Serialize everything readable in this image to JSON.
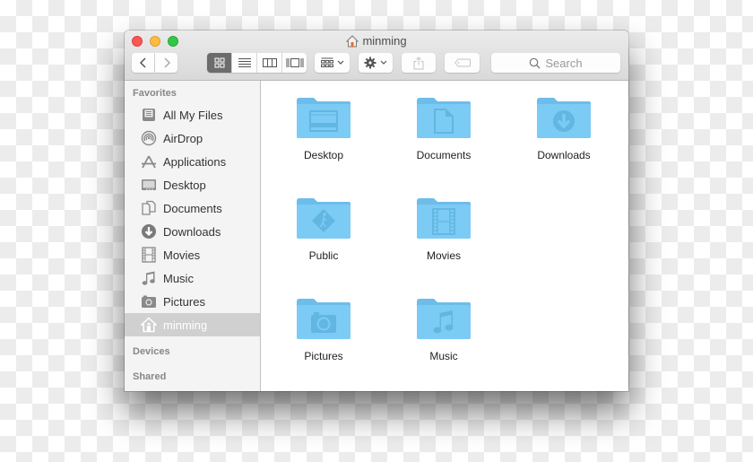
{
  "window": {
    "title": "minming",
    "title_icon": "home-icon"
  },
  "toolbar": {
    "back_icon": "chevron-left-icon",
    "forward_icon": "chevron-right-icon",
    "view_modes": [
      {
        "name": "icon-view",
        "icon": "grid-icon",
        "active": true
      },
      {
        "name": "list-view",
        "icon": "list-icon",
        "active": false
      },
      {
        "name": "column-view",
        "icon": "columns-icon",
        "active": false
      },
      {
        "name": "cover-flow-view",
        "icon": "cover-flow-icon",
        "active": false
      }
    ],
    "arrange_icon": "arrange-grid-icon",
    "action_icon": "gear-icon",
    "share_icon": "share-icon",
    "tag_icon": "tag-icon",
    "search_placeholder": "Search"
  },
  "sidebar": {
    "favorites_heading": "Favorites",
    "items": [
      {
        "label": "All My Files",
        "icon": "all-files-icon"
      },
      {
        "label": "AirDrop",
        "icon": "airdrop-icon"
      },
      {
        "label": "Applications",
        "icon": "applications-icon"
      },
      {
        "label": "Desktop",
        "icon": "desktop-icon"
      },
      {
        "label": "Documents",
        "icon": "documents-icon"
      },
      {
        "label": "Downloads",
        "icon": "downloads-icon"
      },
      {
        "label": "Movies",
        "icon": "movies-icon"
      },
      {
        "label": "Music",
        "icon": "music-icon"
      },
      {
        "label": "Pictures",
        "icon": "pictures-icon"
      },
      {
        "label": "minming",
        "icon": "home-icon",
        "selected": true
      }
    ],
    "devices_heading": "Devices",
    "shared_heading": "Shared"
  },
  "folders": [
    {
      "label": "Desktop",
      "glyph": "desktop"
    },
    {
      "label": "Documents",
      "glyph": "document"
    },
    {
      "label": "Downloads",
      "glyph": "download"
    },
    {
      "label": "Public",
      "glyph": "public"
    },
    {
      "label": "Movies",
      "glyph": "film"
    },
    {
      "label": "Pictures",
      "glyph": "camera"
    },
    {
      "label": "Music",
      "glyph": "music"
    }
  ],
  "colors": {
    "folder_fill": "#7ccbf4",
    "folder_tab": "#6dbdea",
    "folder_glyph": "#62b6e2",
    "selection": "#d0d0d0"
  }
}
